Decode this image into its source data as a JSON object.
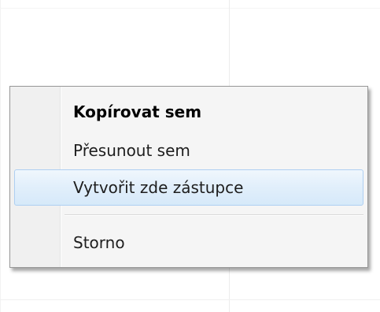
{
  "context_menu": {
    "items": [
      {
        "label": "Kopírovat sem",
        "default": true
      },
      {
        "label": "Přesunout sem"
      },
      {
        "label": "Vytvořit zde zástupce",
        "highlighted": true
      },
      {
        "label": "Storno"
      }
    ]
  },
  "colors": {
    "menu_background": "#f5f5f5",
    "menu_border": "#979797",
    "highlight_border": "#aecff2",
    "highlight_fill": "#e2effb"
  }
}
